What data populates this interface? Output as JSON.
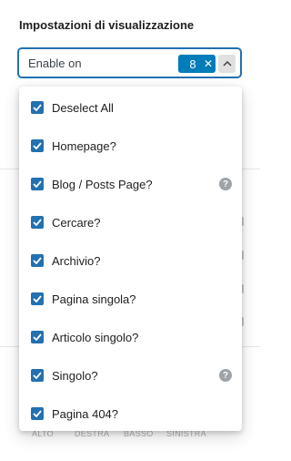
{
  "panel": {
    "heading": "Impostazioni di visualizzazione"
  },
  "select": {
    "value": "Enable on",
    "selected_count": "8",
    "clear_icon": "close-icon",
    "toggle_icon": "chevron-up-icon"
  },
  "colors": {
    "accent": "#2271b1",
    "badge": "#007cba",
    "help": "#9ea3a8"
  },
  "background": {
    "sides": [
      "ALTO",
      "DESTRA",
      "BASSO",
      "SINISTRA"
    ]
  },
  "dropdown": {
    "options": [
      {
        "label": "Deselect All",
        "checked": true,
        "help": false
      },
      {
        "label": "Homepage?",
        "checked": true,
        "help": false
      },
      {
        "label": "Blog / Posts Page?",
        "checked": true,
        "help": true
      },
      {
        "label": "Cercare?",
        "checked": true,
        "help": false
      },
      {
        "label": "Archivio?",
        "checked": true,
        "help": false
      },
      {
        "label": "Pagina singola?",
        "checked": true,
        "help": false
      },
      {
        "label": "Articolo singolo?",
        "checked": true,
        "help": false
      },
      {
        "label": "Singolo?",
        "checked": true,
        "help": true
      },
      {
        "label": "Pagina 404?",
        "checked": true,
        "help": false
      }
    ],
    "help_glyph": "?"
  }
}
